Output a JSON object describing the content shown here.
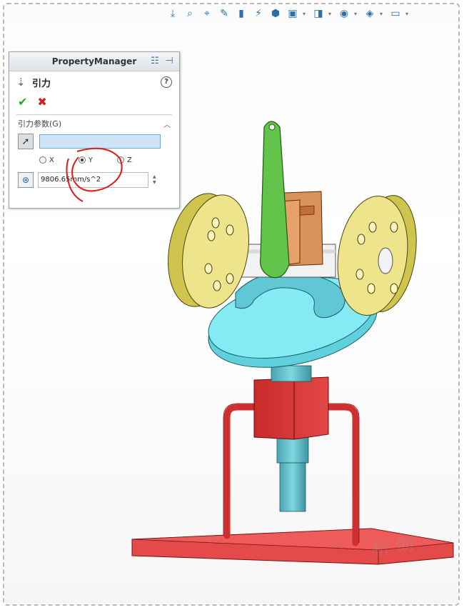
{
  "hud_toolbar": {
    "icons": [
      "zoom-to-fit-icon",
      "zoom-area-icon",
      "previous-view-icon",
      "section-view-icon",
      "dynamic-annotation-icon",
      "view-orientation-icon",
      "display-style-icon",
      "hide-show-icon",
      "edit-appearance-icon",
      "apply-scene-icon",
      "view-settings-icon"
    ]
  },
  "property_manager": {
    "title": "PropertyManager",
    "feature_name": "引力",
    "group_title": "引力参数(G)",
    "radio_options": [
      {
        "label": "X",
        "selected": false
      },
      {
        "label": "Y",
        "selected": true
      },
      {
        "label": "Z",
        "selected": false
      }
    ],
    "gravity_value": "9806.65mm/s^2"
  },
  "colors": {
    "arm": "#5cbf4a",
    "disc": "#e8e07a",
    "cam": "#7fe8f2",
    "block": "#d93535",
    "shaft": "#5bb8c4",
    "base": "#e44848",
    "annotation": "#e01818"
  }
}
